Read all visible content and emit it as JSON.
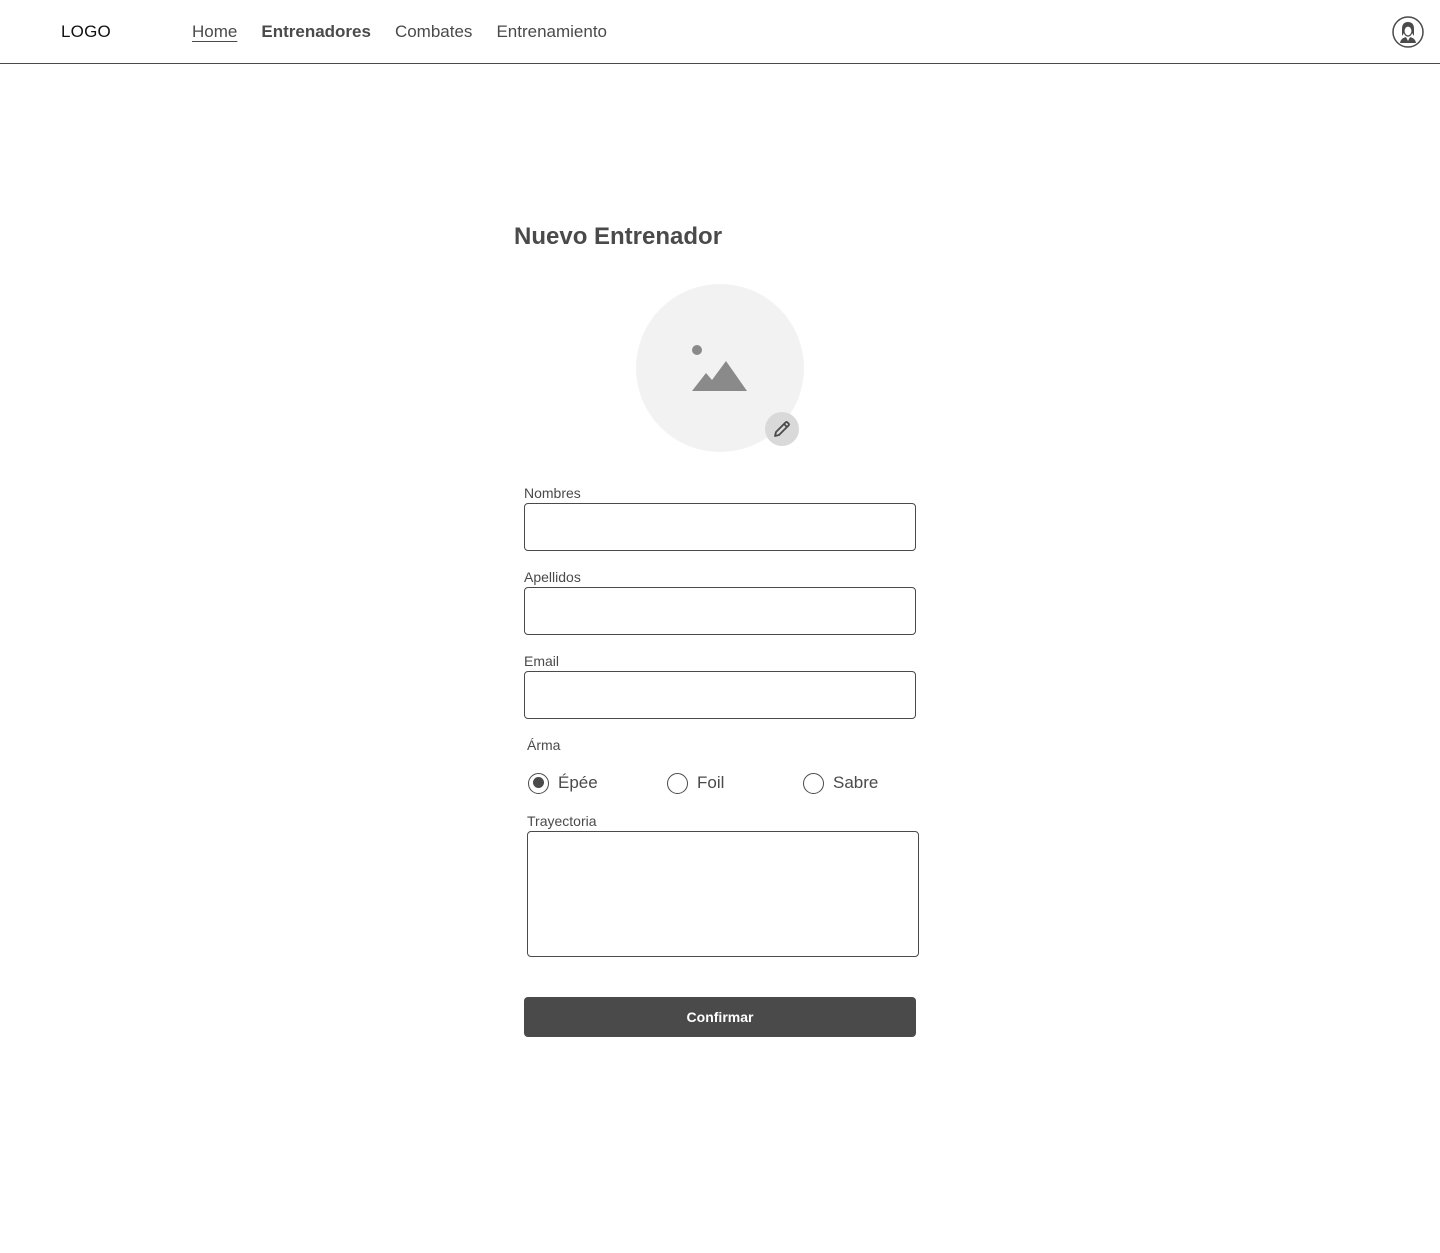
{
  "header": {
    "logo": "LOGO",
    "nav": [
      {
        "label": "Home"
      },
      {
        "label": "Entrenadores"
      },
      {
        "label": "Combates"
      },
      {
        "label": "Entrenamiento"
      }
    ],
    "avatar_icon": "user-avatar-icon"
  },
  "form": {
    "title": "Nuevo Entrenador",
    "photo_icon": "image-placeholder-icon",
    "edit_icon": "pencil-icon",
    "fields": {
      "nombres": {
        "label": "Nombres",
        "value": "",
        "placeholder": ""
      },
      "apellidos": {
        "label": "Apellidos",
        "value": "",
        "placeholder": ""
      },
      "email": {
        "label": "Email",
        "value": "",
        "placeholder": ""
      }
    },
    "arma": {
      "label": "Árma",
      "options": [
        "Épée",
        "Foil",
        "Sabre"
      ],
      "selected": "Épée"
    },
    "trayectoria": {
      "label": "Trayectoria",
      "value": ""
    },
    "confirm_label": "Confirmar"
  },
  "colors": {
    "primary": "#4a4a4a",
    "placeholder_bg": "#f2f2f2",
    "edit_button_bg": "#d9d9d9"
  }
}
